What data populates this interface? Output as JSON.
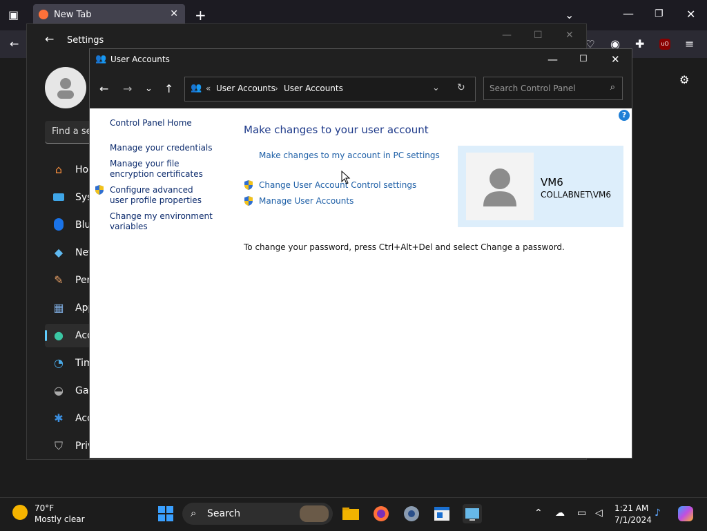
{
  "firefox": {
    "tab_title": "New Tab",
    "tab_close": "✕",
    "new_tab": "+",
    "colors": {
      "tabbar": "#1c1b22",
      "toolbar": "#2b2a33"
    }
  },
  "settings": {
    "title": "Settings",
    "find_placeholder": "Find a se",
    "nav": [
      {
        "label": "Hon",
        "icon": "home-icon"
      },
      {
        "label": "Syst",
        "icon": "system-icon"
      },
      {
        "label": "Blue",
        "icon": "bluetooth-icon"
      },
      {
        "label": "Net",
        "icon": "wifi-icon"
      },
      {
        "label": "Pers",
        "icon": "brush-icon"
      },
      {
        "label": "App",
        "icon": "apps-icon"
      },
      {
        "label": "Acc",
        "icon": "accounts-icon"
      },
      {
        "label": "Tim",
        "icon": "time-icon"
      },
      {
        "label": "Gar",
        "icon": "gaming-icon"
      },
      {
        "label": "Acc",
        "icon": "accessibility-icon"
      },
      {
        "label": "Priv",
        "icon": "privacy-shield-icon"
      }
    ]
  },
  "ua": {
    "title": "User Accounts",
    "breadcrumb": [
      "User Accounts",
      "User Accounts"
    ],
    "breadcrumb_sep": "›",
    "breadcrumb_prefix": "«",
    "search_placeholder": "Search Control Panel",
    "help": "?",
    "left": {
      "home": "Control Panel Home",
      "links": [
        {
          "text": "Manage your credentials",
          "shield": false
        },
        {
          "text": "Manage your file encryption certificates",
          "shield": false
        },
        {
          "text": "Configure advanced user profile properties",
          "shield": true
        },
        {
          "text": "Change my environment variables",
          "shield": false
        }
      ]
    },
    "heading": "Make changes to your user account",
    "pc_settings_link": "Make changes to my account in PC settings",
    "uac_link": "Change User Account Control settings",
    "manage_link": "Manage User Accounts",
    "user_name": "VM6",
    "user_domain": "COLLABNET\\VM6",
    "password_text": "To change your password, press Ctrl+Alt+Del and select Change a password.",
    "colors": {
      "link": "#1c5ea6",
      "heading": "#1e3a8a",
      "userbox": "#ddeefb"
    }
  },
  "taskbar": {
    "weather_temp": "70°F",
    "weather_cond": "Mostly clear",
    "search_label": "Search",
    "time": "1:21 AM",
    "date": "7/1/2024"
  }
}
